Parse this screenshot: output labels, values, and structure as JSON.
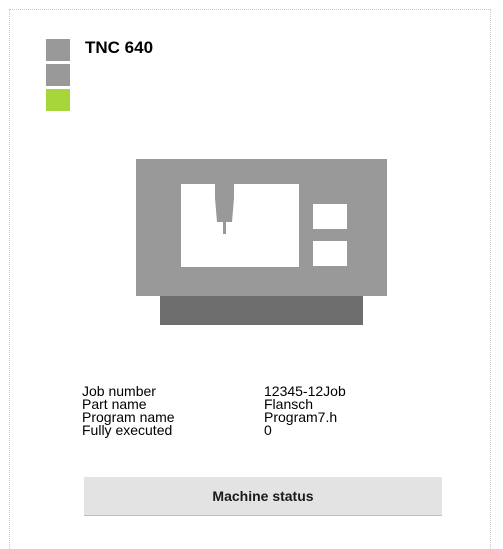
{
  "machine": {
    "name": "TNC 640"
  },
  "status_signal": {
    "red_color": "#999999",
    "yellow_color": "#999999",
    "green_color": "#a6d63a",
    "active": "green"
  },
  "illustration": {
    "icon": "cnc-machine-icon",
    "body_color": "#999999",
    "base_color": "#6e6e6e",
    "window_color": "#ffffff"
  },
  "info": [
    {
      "label": "Job number",
      "value": "12345-12Job"
    },
    {
      "label": "Part name",
      "value": "Flansch"
    },
    {
      "label": "Program name",
      "value": "Program7.h"
    },
    {
      "label": "Fully executed",
      "value": "0"
    }
  ],
  "actions": {
    "status_button_label": "Machine status"
  }
}
